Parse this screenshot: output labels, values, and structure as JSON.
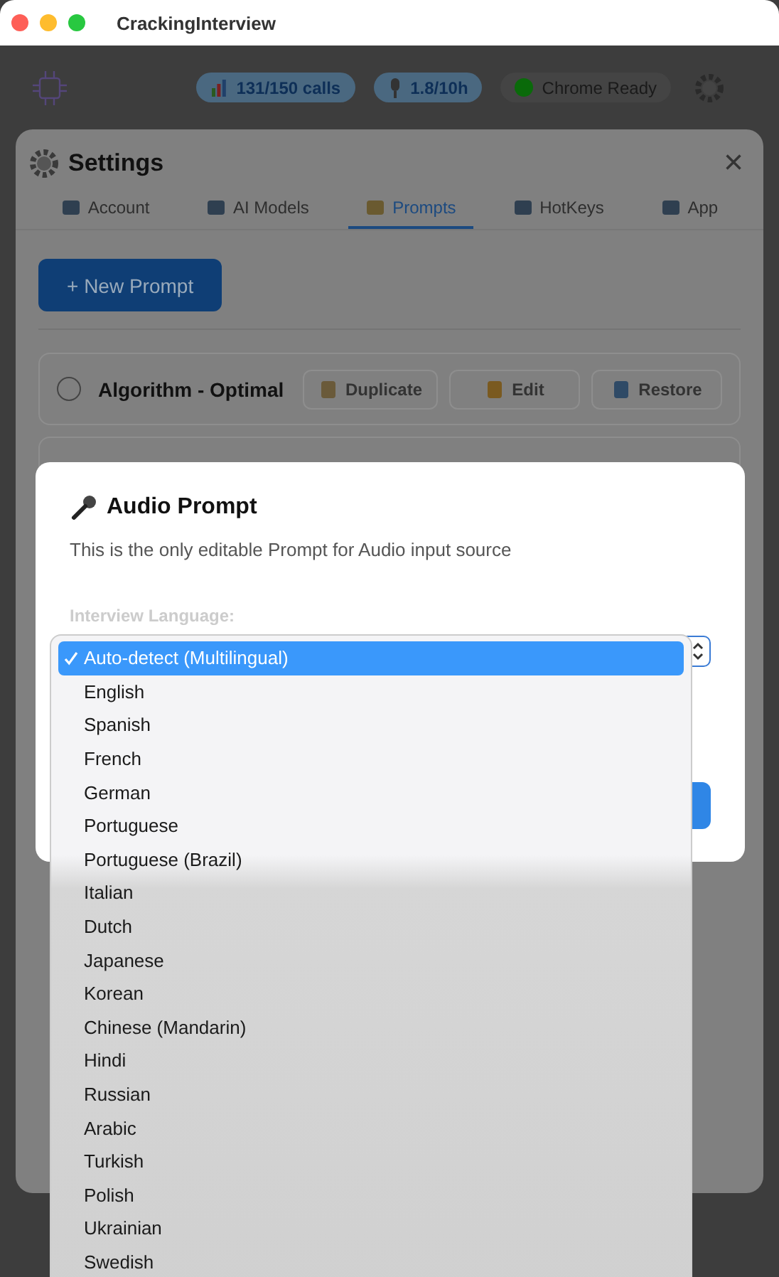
{
  "window": {
    "title": "CrackingInterview"
  },
  "header": {
    "badges": [
      {
        "kind": "usage",
        "text": "131/150 calls"
      },
      {
        "kind": "time",
        "text": "1.8/10h"
      },
      {
        "kind": "status",
        "text": "Chrome Ready"
      }
    ]
  },
  "settings": {
    "title": "Settings",
    "close": "×",
    "tabs": [
      {
        "label": "Account",
        "selected": false
      },
      {
        "label": "AI Models",
        "selected": false
      },
      {
        "label": "Prompts",
        "selected": true
      },
      {
        "label": "HotKeys",
        "selected": false
      },
      {
        "label": "App",
        "selected": false
      }
    ],
    "new_button": "+ New Prompt",
    "prompts": [
      {
        "name": "Algorithm - Optimal",
        "selected": false,
        "actions": [
          "Duplicate",
          "Edit",
          "Restore"
        ]
      }
    ]
  },
  "audio_dialog": {
    "title": "Audio Prompt",
    "description": "This is the only editable Prompt for Audio input source",
    "language_label": "Interview Language:",
    "options": [
      {
        "label": "Auto-detect (Multilingual)",
        "selected": true
      },
      {
        "label": "English",
        "selected": false
      },
      {
        "label": "Spanish",
        "selected": false
      },
      {
        "label": "French",
        "selected": false
      },
      {
        "label": "German",
        "selected": false
      },
      {
        "label": "Portuguese",
        "selected": false
      },
      {
        "label": "Portuguese (Brazil)",
        "selected": false
      },
      {
        "label": "Italian",
        "selected": false
      },
      {
        "label": "Dutch",
        "selected": false
      },
      {
        "label": "Japanese",
        "selected": false
      },
      {
        "label": "Korean",
        "selected": false
      },
      {
        "label": "Chinese (Mandarin)",
        "selected": false
      },
      {
        "label": "Hindi",
        "selected": false
      },
      {
        "label": "Russian",
        "selected": false
      },
      {
        "label": "Arabic",
        "selected": false
      },
      {
        "label": "Turkish",
        "selected": false
      },
      {
        "label": "Polish",
        "selected": false
      },
      {
        "label": "Ukrainian",
        "selected": false
      },
      {
        "label": "Swedish",
        "selected": false
      }
    ]
  }
}
